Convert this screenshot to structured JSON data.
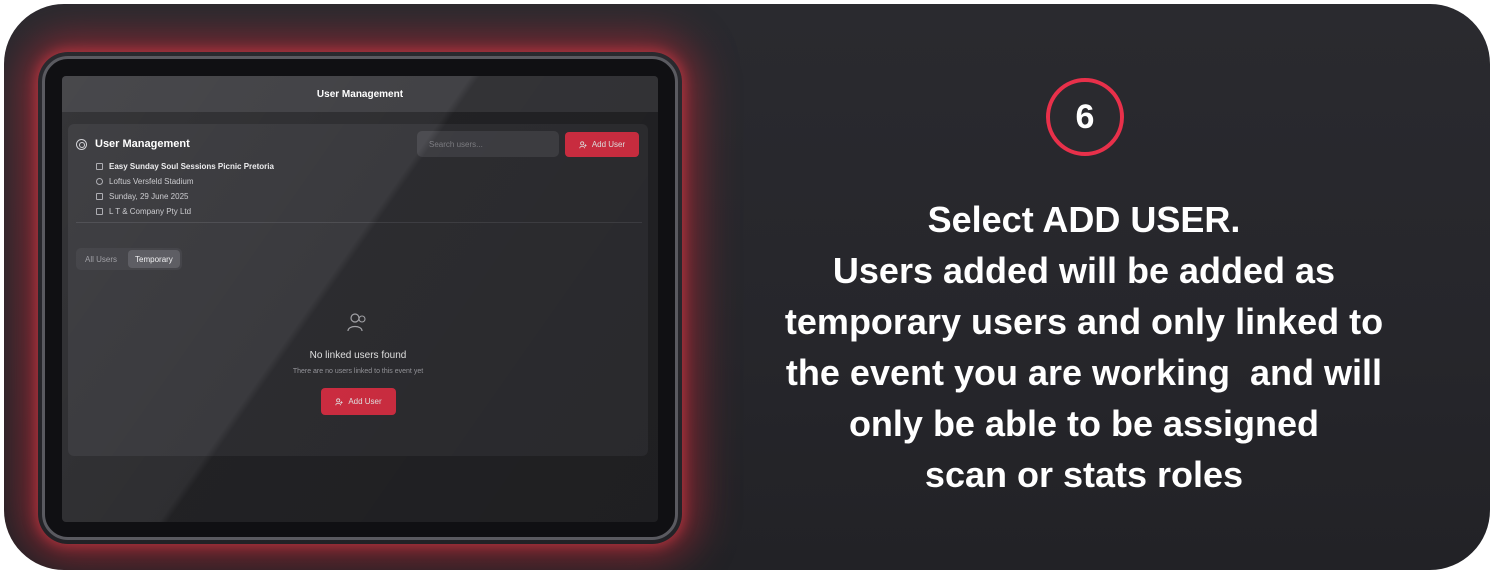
{
  "step": {
    "number": "6"
  },
  "instructions": [
    "Select ADD USER.",
    "Users added will be added as",
    "temporary users and only linked to",
    "the event you are working  and will",
    "only be able to be assigned",
    "scan or stats roles"
  ],
  "app": {
    "header_title": "User Management",
    "section_title": "User Management",
    "event": {
      "name": "Easy Sunday Soul Sessions Picnic Pretoria",
      "venue": "Loftus Versfeld Stadium",
      "date": "Sunday, 29 June 2025",
      "company": "L T & Company Pty Ltd"
    },
    "search": {
      "placeholder": "Search users..."
    },
    "add_user_label": "Add User",
    "tabs": [
      {
        "label": "All Users",
        "active": false
      },
      {
        "label": "Temporary",
        "active": true
      }
    ],
    "empty_state": {
      "title": "No linked users found",
      "subtitle": "There are no users linked to this event yet",
      "button_label": "Add User"
    }
  },
  "colors": {
    "accent": "#e83349",
    "background": "#2a2a2f",
    "glow": "#d22837"
  }
}
